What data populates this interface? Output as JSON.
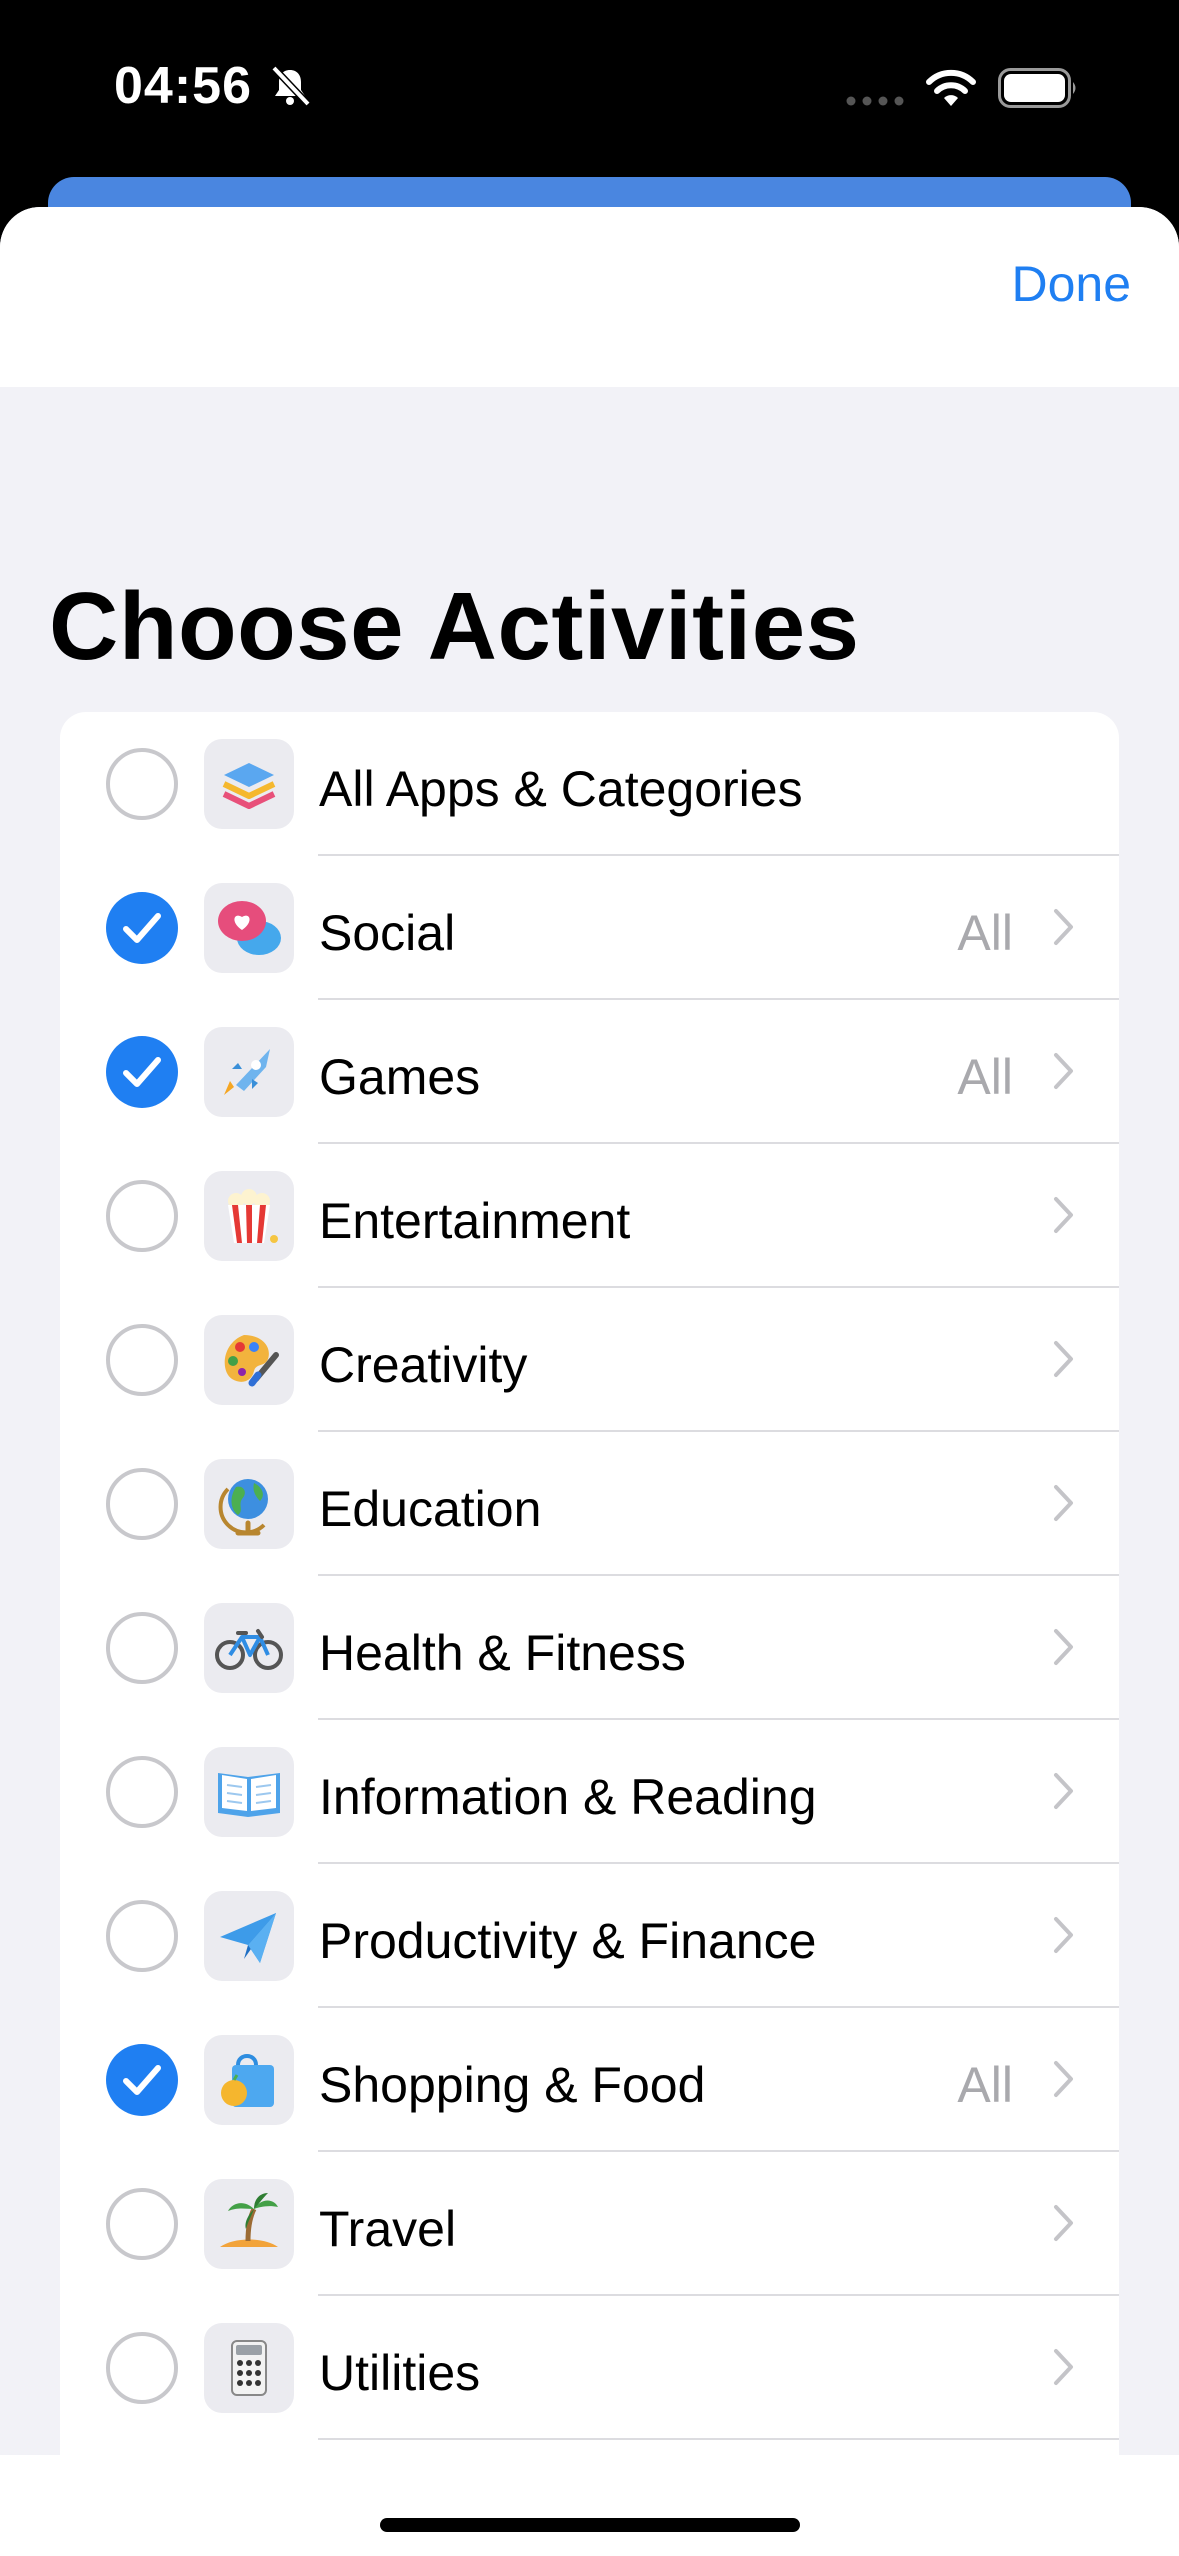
{
  "status": {
    "time": "04:56"
  },
  "nav": {
    "done_label": "Done"
  },
  "page": {
    "title": "Choose Activities"
  },
  "colors": {
    "accent": "#1f7ff2",
    "checkbox_border": "#c8c8cc",
    "secondary_text": "#a9a9ad"
  },
  "categories": [
    {
      "label": "All Apps & Categories",
      "icon": "stack-icon",
      "checked": false,
      "detail": "",
      "chevron": false
    },
    {
      "label": "Social",
      "icon": "chat-heart-icon",
      "checked": true,
      "detail": "All",
      "chevron": true
    },
    {
      "label": "Games",
      "icon": "rocket-icon",
      "checked": true,
      "detail": "All",
      "chevron": true
    },
    {
      "label": "Entertainment",
      "icon": "popcorn-icon",
      "checked": false,
      "detail": "",
      "chevron": true
    },
    {
      "label": "Creativity",
      "icon": "palette-icon",
      "checked": false,
      "detail": "",
      "chevron": true
    },
    {
      "label": "Education",
      "icon": "globe-icon",
      "checked": false,
      "detail": "",
      "chevron": true
    },
    {
      "label": "Health & Fitness",
      "icon": "bicycle-icon",
      "checked": false,
      "detail": "",
      "chevron": true
    },
    {
      "label": "Information & Reading",
      "icon": "book-icon",
      "checked": false,
      "detail": "",
      "chevron": true
    },
    {
      "label": "Productivity & Finance",
      "icon": "paper-plane-icon",
      "checked": false,
      "detail": "",
      "chevron": true
    },
    {
      "label": "Shopping & Food",
      "icon": "shopping-bag-icon",
      "checked": true,
      "detail": "All",
      "chevron": true
    },
    {
      "label": "Travel",
      "icon": "palm-tree-icon",
      "checked": false,
      "detail": "",
      "chevron": true
    },
    {
      "label": "Utilities",
      "icon": "calculator-icon",
      "checked": false,
      "detail": "",
      "chevron": true
    }
  ]
}
